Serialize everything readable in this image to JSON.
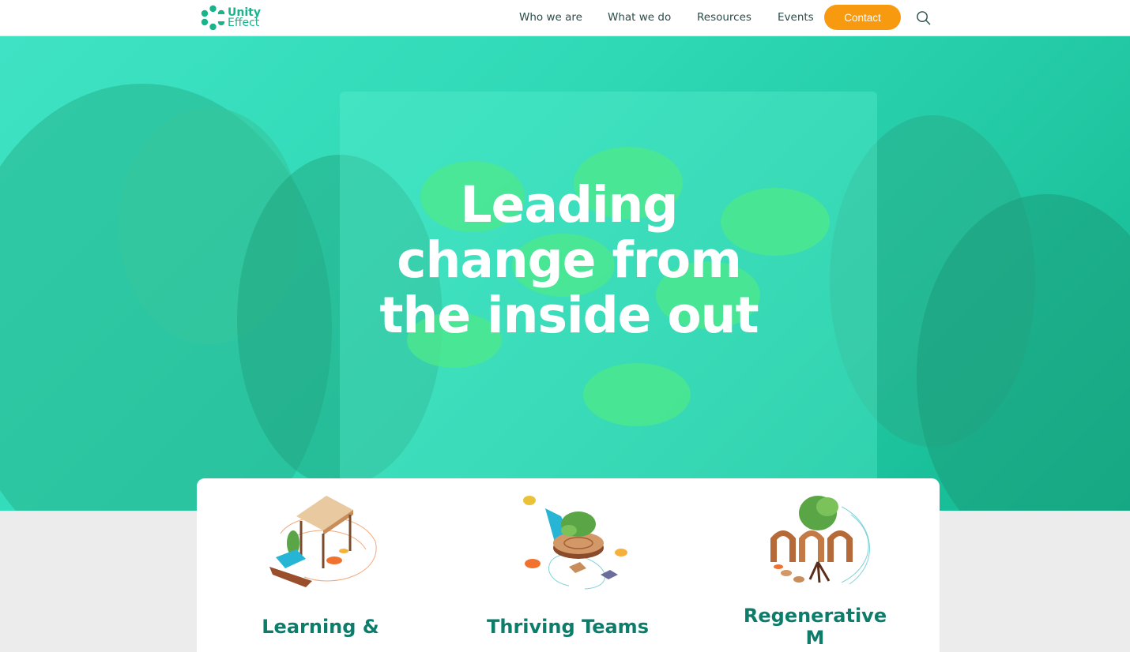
{
  "brand": {
    "name_line1": "Unity",
    "name_line2": "Effect",
    "color": "#19b38c"
  },
  "nav": {
    "items": [
      {
        "label": "Who we are"
      },
      {
        "label": "What we do"
      },
      {
        "label": "Resources"
      },
      {
        "label": "Events"
      }
    ],
    "contact_label": "Contact",
    "contact_color": "#f79a0f",
    "search_icon": "search-icon"
  },
  "hero": {
    "title_line1": "Leading",
    "title_line2": "change from",
    "title_line3": "the inside out",
    "overlay_color": "#2fd9b6"
  },
  "cards": [
    {
      "title_line1": "Learning &",
      "title_line2": "",
      "illustration": "gazebo-boat-illustration"
    },
    {
      "title_line1": "Thriving Teams",
      "title_line2": "",
      "illustration": "tree-stump-watering-illustration"
    },
    {
      "title_line1": "Regenerative",
      "title_line2": "M",
      "illustration": "arches-tree-illustration"
    }
  ],
  "title_color": "#0d7d6b"
}
